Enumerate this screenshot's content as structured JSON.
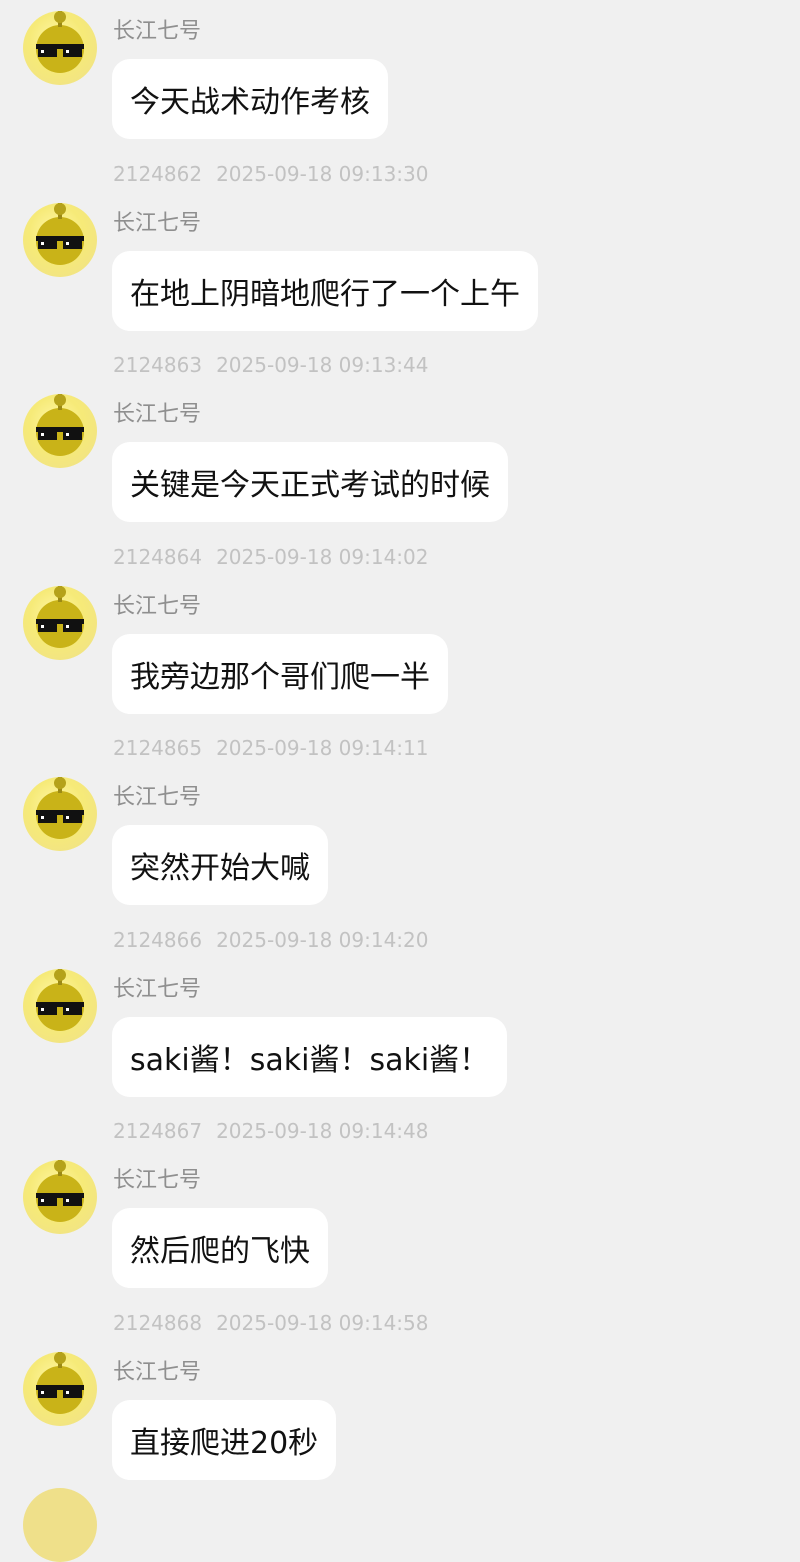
{
  "sender_name": "长江七号",
  "messages": [
    {
      "id": "",
      "time": "",
      "text": "今天战术动作考核"
    },
    {
      "id": "2124862",
      "time": "2025-09-18 09:13:30",
      "text": "在地上阴暗地爬行了一个上午"
    },
    {
      "id": "2124863",
      "time": "2025-09-18 09:13:44",
      "text": "关键是今天正式考试的时候"
    },
    {
      "id": "2124864",
      "time": "2025-09-18 09:14:02",
      "text": "我旁边那个哥们爬一半"
    },
    {
      "id": "2124865",
      "time": "2025-09-18 09:14:11",
      "text": "突然开始大喊"
    },
    {
      "id": "2124866",
      "time": "2025-09-18 09:14:20",
      "text": "saki酱！saki酱！saki酱！"
    },
    {
      "id": "2124867",
      "time": "2025-09-18 09:14:48",
      "text": "然后爬的飞快"
    },
    {
      "id": "2124868",
      "time": "2025-09-18 09:14:58",
      "text": "直接爬进20秒"
    }
  ],
  "avatar_icon": "yellow-character-with-pixel-sunglasses",
  "colors": {
    "background": "#f0f0f0",
    "bubble": "#ffffff",
    "meta_text": "#c2c2c2",
    "sender_text": "#8f8f8f",
    "avatar_yellow": "#f6ea78"
  }
}
